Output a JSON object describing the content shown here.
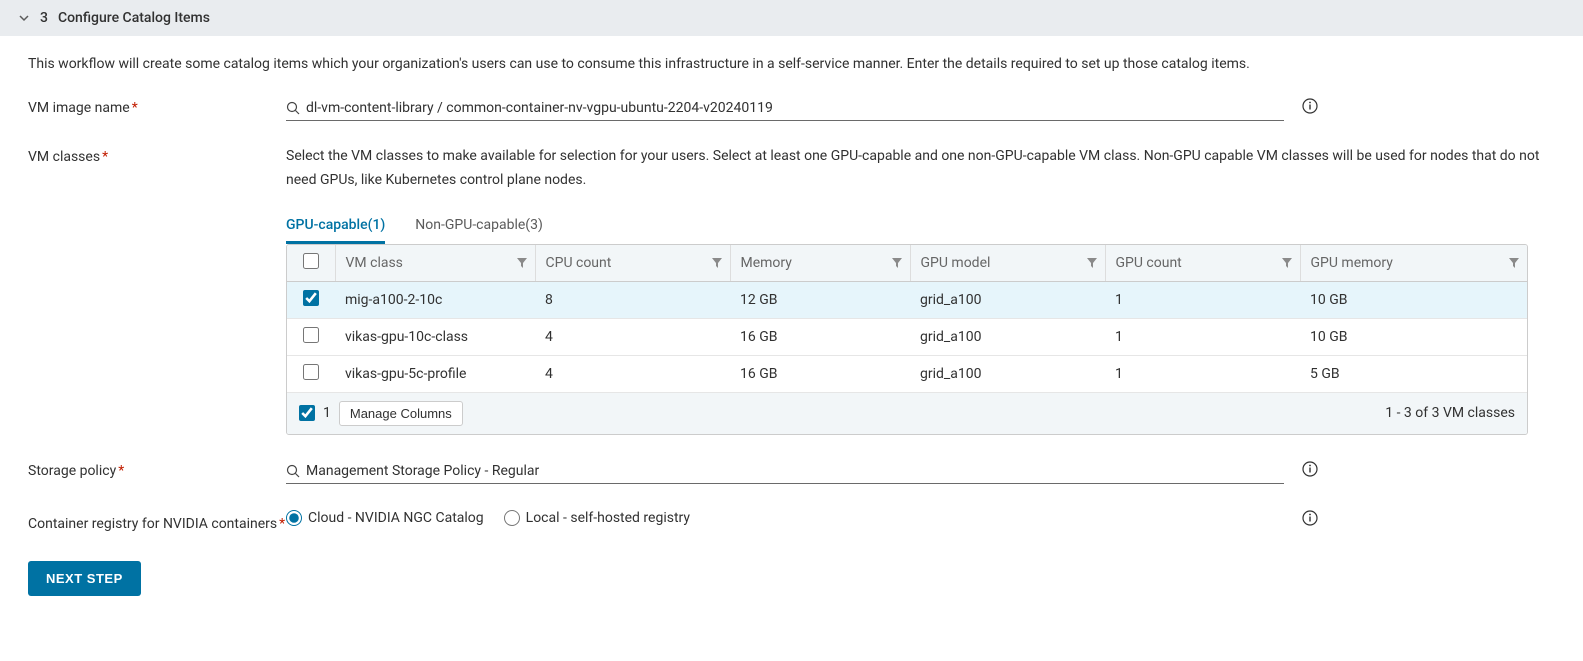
{
  "header": {
    "step_num": "3",
    "title": "Configure Catalog Items"
  },
  "intro": "This workflow will create some catalog items which your organization's users can use to consume this infrastructure in a self-service manner. Enter the details required to set up those catalog items.",
  "vm_image": {
    "label": "VM image name",
    "value": "dl-vm-content-library / common-container-nv-vgpu-ubuntu-2204-v20240119"
  },
  "vm_classes": {
    "label": "VM classes",
    "desc": "Select the VM classes to make available for selection for your users. Select at least one GPU-capable and one non-GPU-capable VM class. Non-GPU capable VM classes will be used for nodes that do not need GPUs, like Kubernetes control plane nodes.",
    "tabs": {
      "gpu": "GPU-capable(1)",
      "nongpu": "Non-GPU-capable(3)"
    },
    "columns": {
      "vmclass": "VM class",
      "cpu": "CPU count",
      "memory": "Memory",
      "gpumodel": "GPU model",
      "gpucount": "GPU count",
      "gpumem": "GPU memory"
    },
    "rows": [
      {
        "selected": true,
        "vmclass": "mig-a100-2-10c",
        "cpu": "8",
        "memory": "12 GB",
        "gpumodel": "grid_a100",
        "gpucount": "1",
        "gpumem": "10 GB"
      },
      {
        "selected": false,
        "vmclass": "vikas-gpu-10c-class",
        "cpu": "4",
        "memory": "16 GB",
        "gpumodel": "grid_a100",
        "gpucount": "1",
        "gpumem": "10 GB"
      },
      {
        "selected": false,
        "vmclass": "vikas-gpu-5c-profile",
        "cpu": "4",
        "memory": "16 GB",
        "gpumodel": "grid_a100",
        "gpucount": "1",
        "gpumem": "5 GB"
      }
    ],
    "footer": {
      "selected_count": "1",
      "manage_cols": "Manage Columns",
      "summary": "1 - 3 of 3 VM classes"
    }
  },
  "storage": {
    "label": "Storage policy",
    "value": "Management Storage Policy - Regular"
  },
  "registry": {
    "label": "Container registry for NVIDIA containers",
    "cloud": "Cloud - NVIDIA NGC Catalog",
    "local": "Local - self-hosted registry"
  },
  "next": "NEXT STEP"
}
